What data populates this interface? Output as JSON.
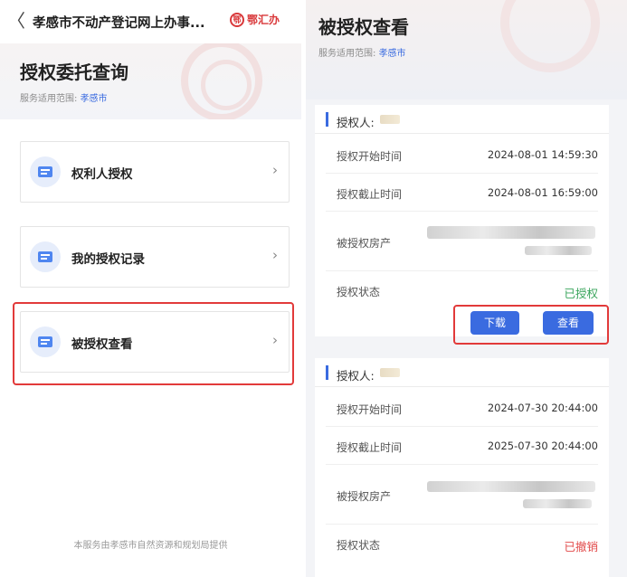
{
  "left": {
    "topbar": {
      "back_glyph": "〈",
      "title": "孝感市不动产登记网上办事...",
      "brand_logo_char": "鄂",
      "brand_text": "鄂汇办"
    },
    "hero": {
      "title": "授权委托查询",
      "scope_label": "服务适用范围:",
      "scope_city": "孝感市"
    },
    "menu": [
      {
        "label": "权利人授权",
        "icon": "document-icon"
      },
      {
        "label": "我的授权记录",
        "icon": "document-icon"
      },
      {
        "label": "被授权查看",
        "icon": "document-icon",
        "highlighted": true
      }
    ],
    "chevron": "›",
    "footer": "本服务由孝感市自然资源和规划局提供"
  },
  "right": {
    "hero": {
      "title": "被授权查看",
      "scope_label": "服务适用范围:",
      "scope_city": "孝感市"
    },
    "records": [
      {
        "header_label": "授权人:",
        "rows": [
          {
            "key": "授权开始时间",
            "value": "2024-08-01 14:59:30"
          },
          {
            "key": "授权截止时间",
            "value": "2024-08-01 16:59:00"
          },
          {
            "key": "被授权房产",
            "value": ""
          },
          {
            "key": "授权状态",
            "value": "已授权"
          }
        ],
        "buttons": {
          "download": "下载",
          "view": "查看"
        }
      },
      {
        "header_label": "授权人:",
        "rows": [
          {
            "key": "授权开始时间",
            "value": "2024-07-30 20:44:00"
          },
          {
            "key": "授权截止时间",
            "value": "2025-07-30 20:44:00"
          },
          {
            "key": "被授权房产",
            "value": ""
          },
          {
            "key": "授权状态",
            "value": "已撤销"
          }
        ]
      }
    ]
  },
  "colors": {
    "accent": "#3a6be0",
    "status_ok": "#3aa55c",
    "status_revoked": "#e24a4a",
    "highlight_box": "#e23a3a",
    "brand": "#d9383a"
  }
}
